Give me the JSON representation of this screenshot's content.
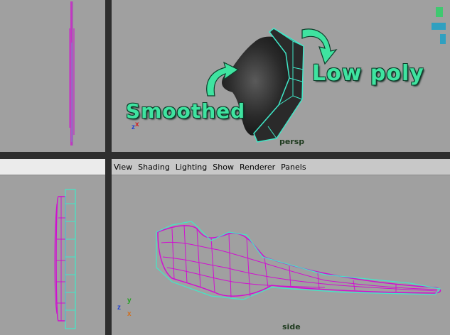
{
  "viewports": {
    "top_left": {
      "name": ""
    },
    "persp": {
      "name": "persp",
      "annotation_low": "Low poly",
      "annotation_smooth": "Smoothed"
    },
    "bottom_left": {
      "name": ""
    },
    "side": {
      "name": "side"
    }
  },
  "panel_menu": {
    "items": [
      "View",
      "Shading",
      "Lighting",
      "Show",
      "Renderer",
      "Panels"
    ]
  },
  "axes": {
    "persp": {
      "a": "z",
      "b": "x"
    },
    "side": {
      "a": "y",
      "b": "z"
    }
  },
  "colors": {
    "viewport_bg": "#a0a0a0",
    "wire_magenta": "#d010d0",
    "wire_cyan": "#40e8c8",
    "annotation": "#3fe3a0"
  }
}
